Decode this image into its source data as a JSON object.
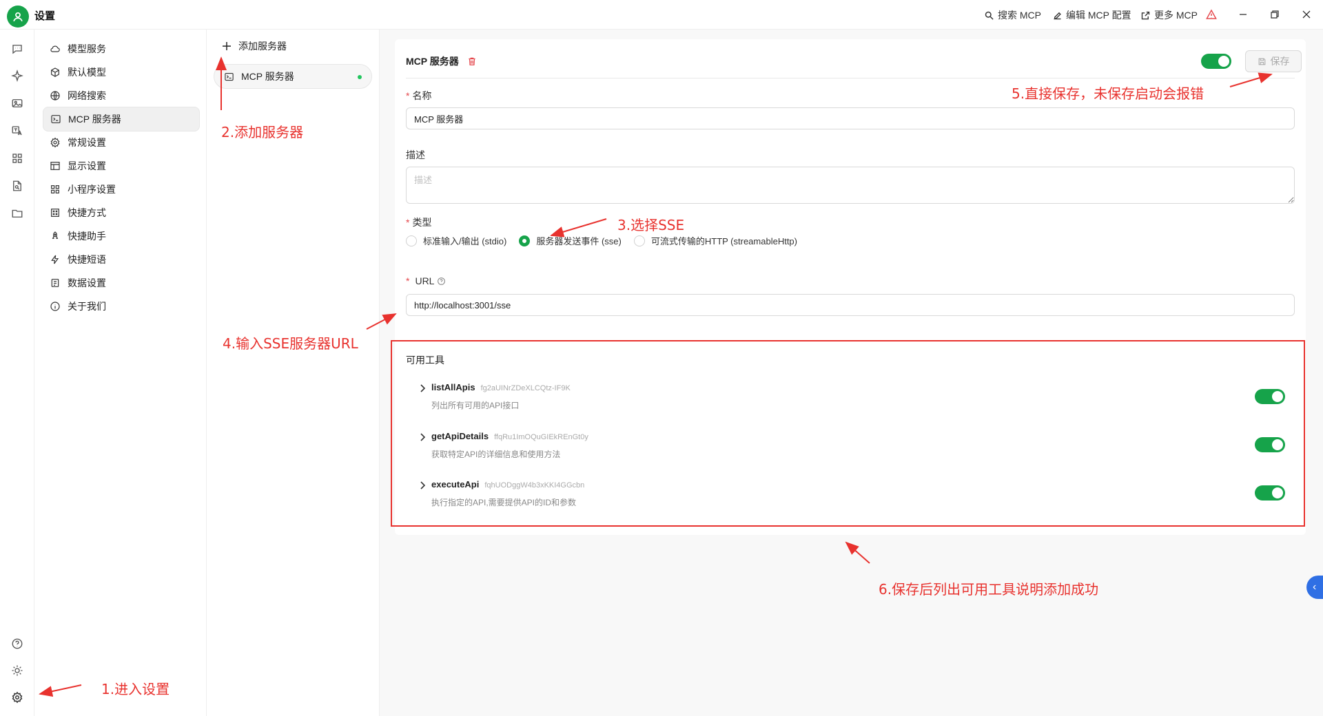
{
  "app": {
    "title": "设置"
  },
  "titlebar": {
    "search_mcp": "搜索 MCP",
    "edit_mcp_config": "编辑 MCP 配置",
    "more_mcp": "更多 MCP"
  },
  "menu": {
    "items": [
      {
        "label": "模型服务",
        "icon": "cloud-icon"
      },
      {
        "label": "默认模型",
        "icon": "cube-icon"
      },
      {
        "label": "网络搜索",
        "icon": "globe-icon"
      },
      {
        "label": "MCP 服务器",
        "icon": "terminal-icon"
      },
      {
        "label": "常规设置",
        "icon": "gear-icon"
      },
      {
        "label": "显示设置",
        "icon": "display-icon"
      },
      {
        "label": "小程序设置",
        "icon": "grid-icon"
      },
      {
        "label": "快捷方式",
        "icon": "keyboard-icon"
      },
      {
        "label": "快捷助手",
        "icon": "rocket-icon"
      },
      {
        "label": "快捷短语",
        "icon": "zap-icon"
      },
      {
        "label": "数据设置",
        "icon": "database-icon"
      },
      {
        "label": "关于我们",
        "icon": "info-icon"
      }
    ],
    "active_index": 3
  },
  "servers": {
    "add_label": "添加服务器",
    "items": [
      {
        "label": "MCP 服务器",
        "status": "active"
      }
    ]
  },
  "form": {
    "title": "MCP 服务器",
    "enabled": true,
    "save_label": "保存",
    "name_label": "名称",
    "name_value": "MCP 服务器",
    "desc_label": "描述",
    "desc_placeholder": "描述",
    "type_label": "类型",
    "type_options": [
      {
        "label": "标准输入/输出 (stdio)",
        "selected": false
      },
      {
        "label": "服务器发送事件 (sse)",
        "selected": true
      },
      {
        "label": "可流式传输的HTTP (streamableHttp)",
        "selected": false
      }
    ],
    "url_label": "URL",
    "url_value": "http://localhost:3001/sse"
  },
  "tools": {
    "title": "可用工具",
    "items": [
      {
        "name": "listAllApis",
        "id": "fg2aUINrZDeXLCQtz-IF9K",
        "desc": "列出所有可用的API接口",
        "enabled": true
      },
      {
        "name": "getApiDetails",
        "id": "ffqRu1ImOQuGIEkREnGt0y",
        "desc": "获取特定API的详细信息和使用方法",
        "enabled": true
      },
      {
        "name": "executeApi",
        "id": "fqhUODggW4b3xKKI4GGcbn",
        "desc": "执行指定的API,需要提供API的ID和参数",
        "enabled": true
      }
    ]
  },
  "annotations": {
    "step1": "1.进入设置",
    "step2": "2.添加服务器",
    "step3": "3.选择SSE",
    "step4": "4.输入SSE服务器URL",
    "step5": "5.直接保存，未保存启动会报错",
    "step6": "6.保存后列出可用工具说明添加成功"
  },
  "colors": {
    "accent": "#16a34a",
    "annotation": "#e8322e",
    "danger": "#e5484d",
    "collapse_tab": "#2f6fe4"
  }
}
